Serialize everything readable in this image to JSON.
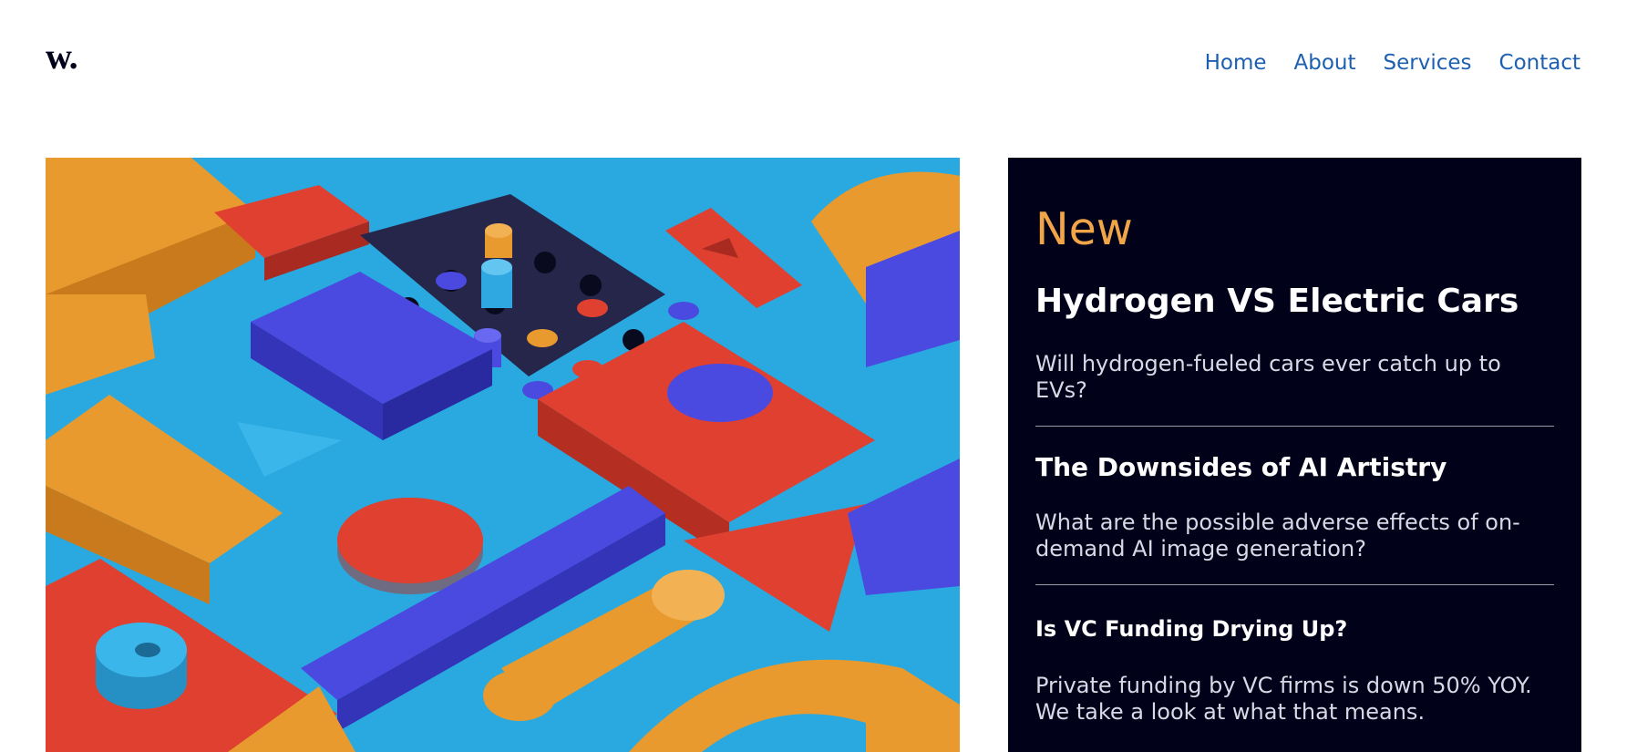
{
  "logo": {
    "text": "w."
  },
  "nav": {
    "items": [
      {
        "label": "Home"
      },
      {
        "label": "About"
      },
      {
        "label": "Services"
      },
      {
        "label": "Contact"
      }
    ]
  },
  "colors": {
    "accent": "#f0a648",
    "nav_link": "#1d5fb0",
    "panel_bg": "#02011a"
  },
  "panel": {
    "title": "New",
    "articles": [
      {
        "title": "Hydrogen VS Electric Cars",
        "summary": "Will hydrogen-fueled cars ever catch up to EVs?"
      },
      {
        "title": "The Downsides of AI Artistry",
        "summary": "What are the possible adverse effects of on-demand AI image generation?"
      },
      {
        "title": "Is VC Funding Drying Up?",
        "summary": "Private funding by VC firms is down 50% YOY. We take a look at what that means."
      }
    ]
  }
}
